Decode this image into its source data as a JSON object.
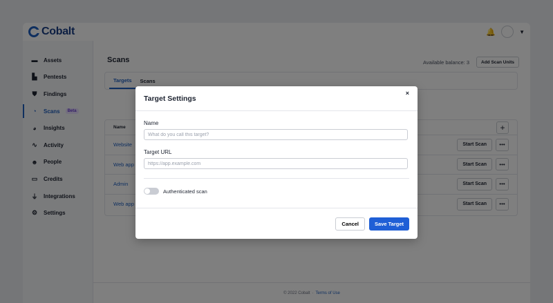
{
  "app": {
    "logo_text": "Cobalt"
  },
  "sidebar": {
    "items": [
      {
        "label": "Assets",
        "icon": "folder-icon"
      },
      {
        "label": "Pentests",
        "icon": "building-icon"
      },
      {
        "label": "Findings",
        "icon": "shield-icon"
      },
      {
        "label": "Scans",
        "icon": "scan-icon",
        "badge": "Beta",
        "active": true
      },
      {
        "label": "Insights",
        "icon": "pie-chart-icon"
      },
      {
        "label": "Activity",
        "icon": "pulse-icon"
      },
      {
        "label": "People",
        "icon": "people-icon"
      },
      {
        "label": "Credits",
        "icon": "wallet-icon"
      },
      {
        "label": "Integrations",
        "icon": "plug-icon"
      },
      {
        "label": "Settings",
        "icon": "gear-icon"
      }
    ]
  },
  "main": {
    "title": "Scans",
    "balance": "Available balance: 3",
    "add_units": "Add Scan Units",
    "tabs": [
      {
        "label": "Targets",
        "active": true
      },
      {
        "label": "Scans"
      }
    ],
    "table": {
      "header_name": "Name",
      "rows": [
        {
          "name": "Website",
          "action": "Start Scan",
          "more": "•••"
        },
        {
          "name": "Web app",
          "action": "Start Scan",
          "more": "•••"
        },
        {
          "name": "Admin",
          "action": "Start Scan",
          "more": "•••"
        },
        {
          "name": "Web app",
          "action": "Start Scan",
          "more": "•••"
        }
      ]
    },
    "footer": {
      "copyright": "© 2022 Cobalt",
      "separator": "·",
      "terms": "Terms of Use"
    }
  },
  "modal": {
    "title": "Target Settings",
    "close": "×",
    "name_label": "Name",
    "name_placeholder": "What do you call this target?",
    "url_label": "Target URL",
    "url_placeholder": "https://app.example.com",
    "toggle_label": "Authenticated scan",
    "authenticated": false,
    "cancel": "Cancel",
    "save": "Save Target"
  },
  "colors": {
    "accent": "#1f5fd6",
    "overlay": "rgba(0,0,0,0.5)"
  }
}
